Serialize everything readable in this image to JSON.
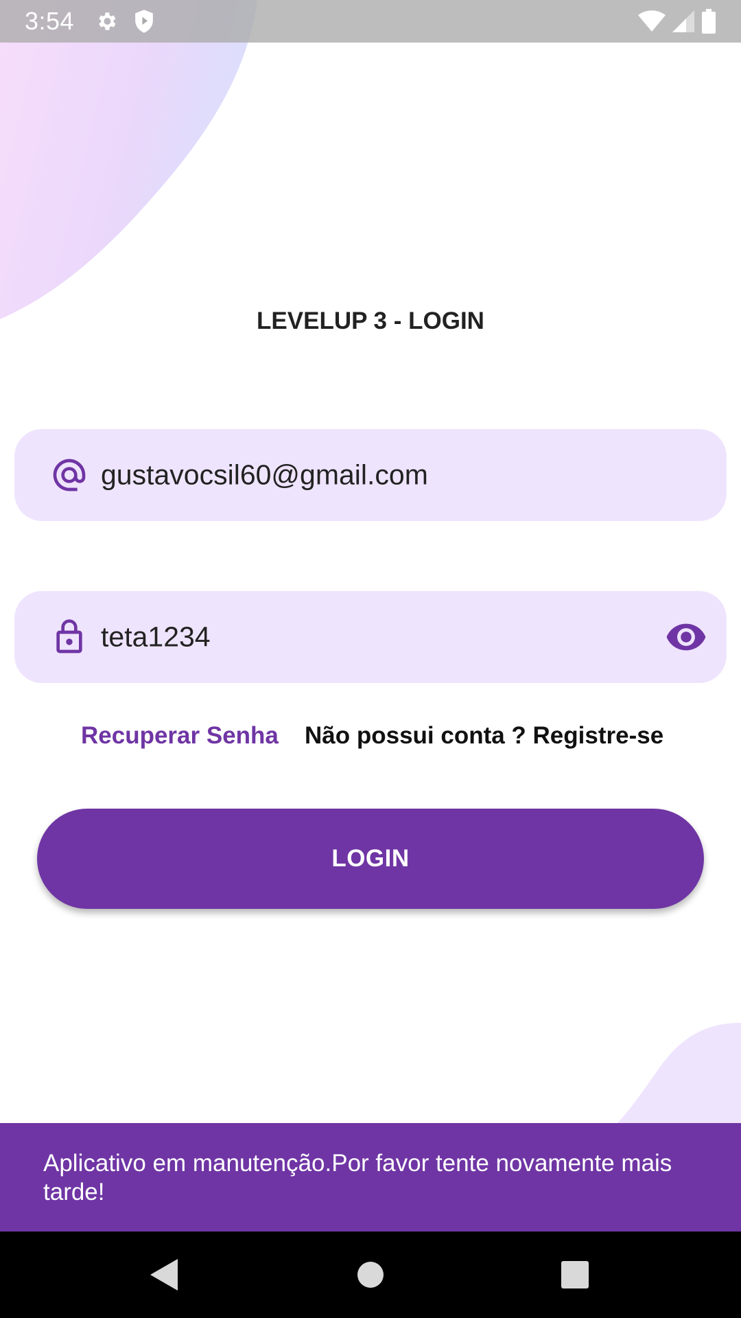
{
  "status_bar": {
    "time": "3:54",
    "icons": [
      "gear-icon",
      "shield-icon",
      "wifi-icon",
      "signal-icon",
      "battery-icon"
    ]
  },
  "login": {
    "title": "LEVELUP 3 - LOGIN",
    "email": {
      "icon": "at-icon",
      "value": "gustavocsil60@gmail.com"
    },
    "password": {
      "icon": "lock-icon",
      "value": "teta1234",
      "toggle_icon": "eye-icon"
    },
    "recover_link": "Recuperar Senha",
    "register_link": "Não possui conta ? Registre-se",
    "button_label": "LOGIN"
  },
  "snackbar": {
    "message": "Aplicativo em manutenção.Por favor tente novamente mais tarde!"
  },
  "navigation": {
    "icons": [
      "back-icon",
      "home-icon",
      "recents-icon"
    ]
  },
  "colors": {
    "primary": "#6f35a4",
    "field_background": "#efe4fd",
    "text": "#222222"
  }
}
